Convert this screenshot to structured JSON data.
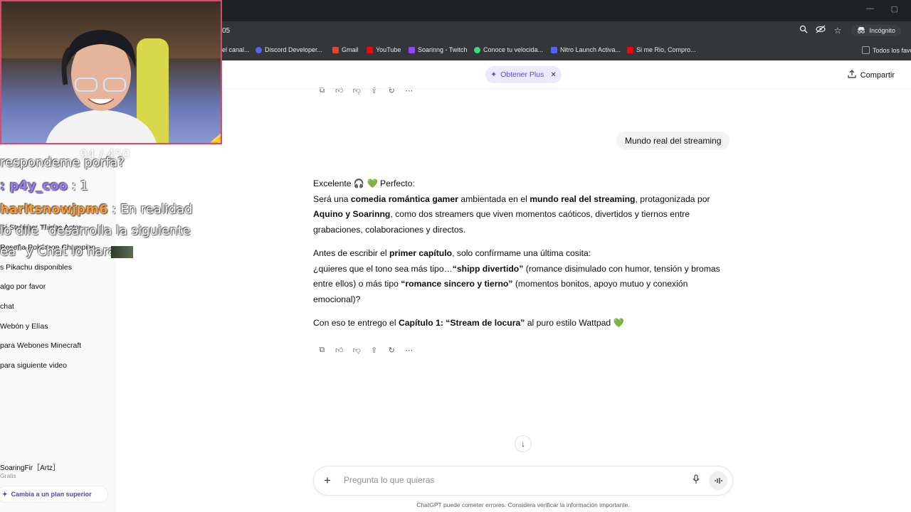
{
  "browser": {
    "url": "05",
    "incognito_label": "Incógnito",
    "bookmarks": [
      {
        "label": "el canal...",
        "color": "#888888"
      },
      {
        "label": "Discord Developer...",
        "color": "#5865f2"
      },
      {
        "label": "Gmail",
        "color": "#ea4335"
      },
      {
        "label": "YouTube",
        "color": "#ff0000"
      },
      {
        "label": "Soarinng - Twitch",
        "color": "#9146ff"
      },
      {
        "label": "Conoce tu velocida...",
        "color": "#3ddc84"
      },
      {
        "label": "Nitro Launch Activa...",
        "color": "#5865f2"
      },
      {
        "label": "Si me Rio, Compro...",
        "color": "#ff0000"
      },
      {
        "label": "Todos los favo",
        "color": "#9aa0a6"
      }
    ]
  },
  "sidebar": {
    "items": [
      "Sí Stranger Things Actor",
      "Reseña Pokémon Champion",
      "s Pikachu disponibles",
      "algo por favor",
      "chat",
      "Webón y Elías",
      " para Webones Minecraft",
      "para siguiente video"
    ],
    "user_name": "SoaringFir［Artz］",
    "user_plan": "Gratis",
    "upgrade_label": "Cambia a un plan superior"
  },
  "header": {
    "plus_label": "Obtener Plus",
    "share_label": "Compartir"
  },
  "conversation": {
    "user_message": "Mundo real del streaming",
    "answer": {
      "p1_line1": "Excelente 🎧 💚 Perfecto:",
      "p1_a": "Será una ",
      "p1_b": "comedia romántica gamer",
      "p1_c": " ambientada en el ",
      "p1_d": "mundo real del streaming",
      "p1_e": ", protagonizada por ",
      "p1_f": "Aquino y Soarinng",
      "p1_g": ", como dos streamers que viven momentos caóticos, divertidos y tiernos entre grabaciones, colaboraciones y directos.",
      "p2_a": "Antes de escribir el ",
      "p2_b": "primer capítulo",
      "p2_c": ", solo confírmame una última cosita:",
      "p2_d": "¿quieres que el tono sea más tipo…",
      "p2_e": "“shipp divertido”",
      "p2_f": " (romance disimulado con humor, tensión y bromas entre ellos) o más tipo ",
      "p2_g": "“romance sincero y tierno”",
      "p2_h": " (momentos bonitos, apoyo mutuo y conexión emocional)?",
      "p3_a": "Con eso te entrego el ",
      "p3_b": "Capítulo 1: “Stream de locura”",
      "p3_c": " al puro estilo Wattpad 💚"
    }
  },
  "composer": {
    "placeholder": "Pregunta lo que quieras",
    "disclaimer": "ChatGPT puede cometer errores. Considera verificar la información importante."
  },
  "stream_overlay": {
    "viewer_count": "94 / 450",
    "chat": [
      {
        "user": "",
        "text": "respondeme porfa?"
      },
      {
        "user": "p4y_coo",
        "text": " : 1"
      },
      {
        "user": "harltsnowjpm6",
        "text": " : En realidad"
      },
      {
        "user": "",
        "text": "lo dile \"desarrolla la siguiente"
      },
      {
        "user": "",
        "text": "ea\" y Chat lo hara"
      }
    ]
  },
  "colors": {
    "accent": "#5b4bd6",
    "webcam_border": "#d94b6a",
    "chat_user1": "#9b7bff",
    "chat_user2": "#ff9b2f"
  }
}
